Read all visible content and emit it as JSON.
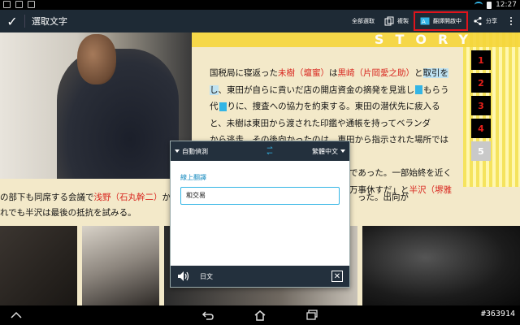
{
  "status_bar": {
    "time": "12:27"
  },
  "action_bar": {
    "title": "選取文字",
    "select_all": "全部選取",
    "copy": "複製",
    "translate": "翻譯開啟中",
    "share": "分享"
  },
  "banner": {
    "word": "STORY"
  },
  "article": {
    "p1": "国税局に寝返った",
    "p2": "未樹（壇蜜）",
    "p3": "は",
    "p4": "黒崎（片岡愛之助）",
    "p5": "と",
    "p6": "取引を",
    "p7": "し",
    "p8": "、東田が自らに貢いだ店の開店資金の摘発を見逃し",
    "p9": "もらう",
    "p10": "代",
    "p11": "りに、捜査への協力を約束する。東田の潜伏先に疲入る",
    "p12": "と、未樹は東田から渡された印鑑や通帳を持ってベランダ",
    "p13": "から逃走。その後向かったのは、東田から指示された場所ではな",
    "p14": "であった。一部始終を近く",
    "p15": "万事休すだ」と",
    "p16": "半沢（堺雅"
  },
  "pages": [
    "1",
    "2",
    "3",
    "4",
    "5"
  ],
  "lower": {
    "a1": "の部下も同席する会議で",
    "a2": "浅野（石丸幹二）",
    "a3": "か",
    "b1": "った。出向が",
    "c1": "れでも半沢は最後の抵抗を試みる。"
  },
  "popup": {
    "source_lang": "自動偵測",
    "target_lang": "繁體中文",
    "label": "線上翻譯",
    "result": "和交易",
    "footer_lang": "日文",
    "close": "✕"
  },
  "watermark": "#363914",
  "colors": {
    "accent": "#33b5e5",
    "highlight_box": "#e0141c",
    "name_red": "#d8261f"
  }
}
